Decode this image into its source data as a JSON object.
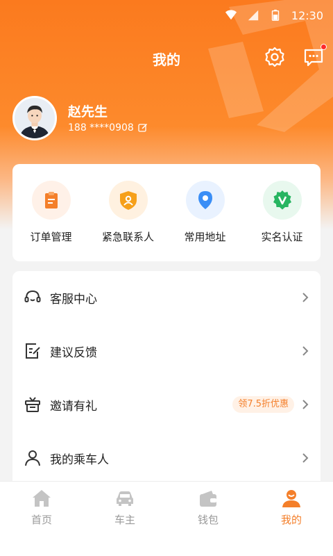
{
  "status_bar": {
    "time": "12:30"
  },
  "nav": {
    "title": "我的"
  },
  "profile": {
    "name": "赵先生",
    "phone": "188 ****0908"
  },
  "quick_actions": [
    {
      "label": "订单管理",
      "icon": "order-clipboard-icon",
      "bg": "#fff1e8",
      "color": "#f47f2a"
    },
    {
      "label": "紧急联系人",
      "icon": "emergency-shield-icon",
      "bg": "#fff1e0",
      "color": "#f6a01a"
    },
    {
      "label": "常用地址",
      "icon": "location-pin-icon",
      "bg": "#e9f2ff",
      "color": "#3a8ef6"
    },
    {
      "label": "实名认证",
      "icon": "verified-badge-icon",
      "bg": "#e8f8ee",
      "color": "#27b561"
    }
  ],
  "menu": [
    {
      "label": "客服中心",
      "icon": "headset-icon"
    },
    {
      "label": "建议反馈",
      "icon": "feedback-edit-icon"
    },
    {
      "label": "邀请有礼",
      "icon": "gift-icon",
      "badge": "领7.5折优惠"
    },
    {
      "label": "我的乘车人",
      "icon": "passenger-person-icon"
    }
  ],
  "tabs": [
    {
      "label": "首页",
      "icon": "home-icon",
      "active": false
    },
    {
      "label": "车主",
      "icon": "car-icon",
      "active": false
    },
    {
      "label": "钱包",
      "icon": "wallet-icon",
      "active": false
    },
    {
      "label": "我的",
      "icon": "profile-icon",
      "active": true
    }
  ],
  "colors": {
    "accent": "#f47f2a",
    "header": "#fb7a1e",
    "inactive": "#9a9a9a"
  }
}
